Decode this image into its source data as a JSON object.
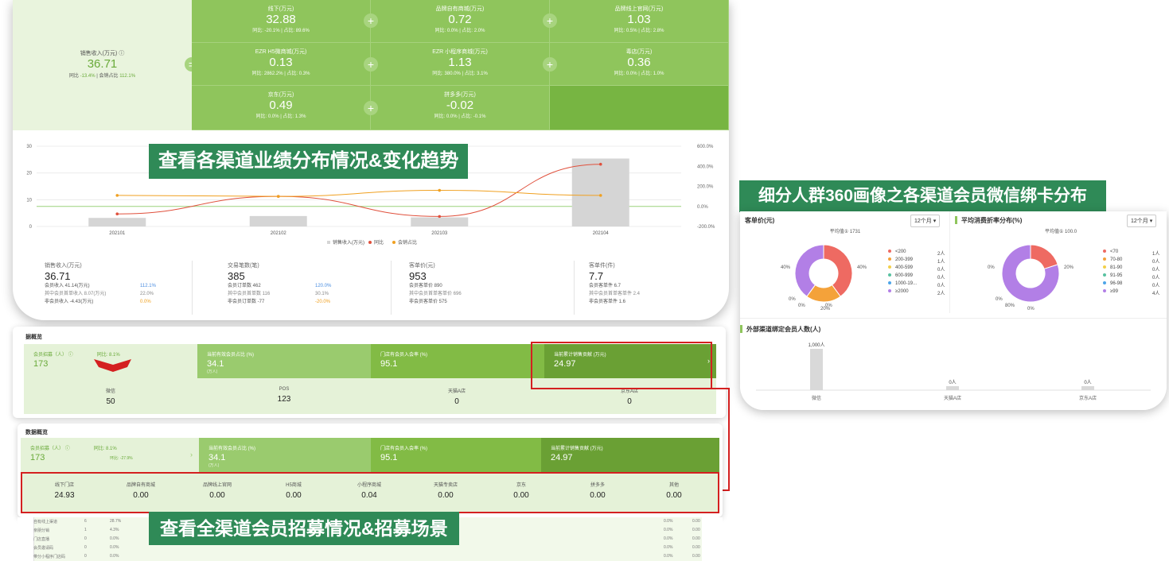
{
  "panelA": {
    "main": {
      "title": "销售收入(万元)",
      "value": "36.71",
      "sub_label1": "同比",
      "sub_value1": "-13.4%",
      "sub_label2": "会销占比",
      "sub_value2": "112.1%"
    },
    "cells": [
      {
        "title": "线下(万元)",
        "value": "32.88",
        "sub": "同比: -20.1% | 占比: 89.6%"
      },
      {
        "title": "品牌自有商城(万元)",
        "value": "0.72",
        "sub": "同比: 0.0% | 占比: 2.0%"
      },
      {
        "title": "品牌线上官网(万元)",
        "value": "1.03",
        "sub": "同比: 0.5% | 占比: 2.8%"
      },
      {
        "title": "EZR H5微商城(万元)",
        "value": "0.13",
        "sub": "同比: 2862.2% | 占比: 0.3%"
      },
      {
        "title": "EZR 小程序商城(万元)",
        "value": "1.13",
        "sub": "同比: 380.0% | 占比: 3.1%"
      },
      {
        "title": "毒店(万元)",
        "value": "0.36",
        "sub": "同比: 0.0% | 占比: 1.0%"
      },
      {
        "title": "京东(万元)",
        "value": "0.49",
        "sub": "同比: 0.0% | 占比: 1.3%"
      },
      {
        "title": "拼多多(万元)",
        "value": "-0.02",
        "sub": "同比: 0.0% | 占比: -0.1%"
      }
    ],
    "chart_data": {
      "type": "bar",
      "categories": [
        "202101",
        "202102",
        "202103",
        "202104"
      ],
      "ylim": [
        0,
        30
      ],
      "yticks": [
        "30",
        "20",
        "10",
        "0"
      ],
      "y2ticks": [
        "600.0%",
        "400.0%",
        "200.0%",
        "0.0%",
        "-200.0%"
      ],
      "series": [
        {
          "name": "销售收入(万元)",
          "values": [
            3.2,
            3.9,
            3.4,
            25.4
          ],
          "color": "#d5d5d5"
        },
        {
          "name": "同比",
          "values": [
            -75,
            100,
            -100,
            420
          ],
          "color": "#e0503c"
        },
        {
          "name": "会销占比",
          "values": [
            110,
            100,
            160,
            110
          ],
          "color": "#f0a020"
        }
      ]
    },
    "stats": [
      {
        "title": "销售收入(万元)",
        "value": "36.71",
        "l1": "会员收入  41.14(万元)",
        "r1": "112.1%",
        "l2": "其中会员首单收入  8.07(万元)",
        "r2": "22.0%",
        "l3": "非会员收入  -4.43(万元)",
        "r3": "0.0%"
      },
      {
        "title": "交易笔数(笔)",
        "value": "385",
        "l1": "会员订单数  462",
        "r1": "120.0%",
        "l2": "其中会员首单数  116",
        "r2": "30.1%",
        "l3": "非会员订单数  -77",
        "r3": "-20.0%"
      },
      {
        "title": "客单价(元)",
        "value": "953",
        "l1": "会员客单价  890",
        "l2": "其中会员首单客单价  696",
        "l3": "非会员客单价  575"
      },
      {
        "title": "客单件(件)",
        "value": "7.7",
        "l1": "会员客单件  6.7",
        "l2": "其中会员首单客单件  2.4",
        "l3": "非会员客单件  1.6"
      }
    ]
  },
  "banners": {
    "a": "查看各渠道业绩分布情况&变化趋势",
    "b": "细分人群360画像之各渠道会员微信绑卡分布",
    "c": "查看全渠道会员招募情况&招募场景"
  },
  "panelB": {
    "header": "据概览",
    "tiles": [
      {
        "title": "会员招募（人）",
        "value": "173",
        "extra": "同比: 8.1%"
      },
      {
        "title": "当前有效会员占比 (%)",
        "value": "34.1",
        "extra": "(万人)"
      },
      {
        "title": "门店有会员入会率 (%)",
        "value": "95.1"
      },
      {
        "title": "当前累计销售贡献 (万元)",
        "value": "24.97"
      }
    ],
    "counts": [
      {
        "label": "微信",
        "value": "50"
      },
      {
        "label": "POS",
        "value": "123"
      },
      {
        "label": "天猫A店",
        "value": "0"
      },
      {
        "label": "京东A店",
        "value": "0"
      }
    ]
  },
  "panelC": {
    "header": "数据概览",
    "tiles": [
      {
        "title": "会员招募（人）",
        "value": "173",
        "extra1": "同比: 8.1%",
        "extra2": "环比: -27.9%"
      },
      {
        "title": "当前有效会员占比 (%)",
        "value": "34.1",
        "extra": "(万人)"
      },
      {
        "title": "门店有会员入会率 (%)",
        "value": "95.1"
      },
      {
        "title": "当前累计销售贡献 (万元)",
        "value": "24.97"
      }
    ],
    "columns": [
      {
        "label": "线下门店",
        "value": "24.93"
      },
      {
        "label": "品牌自有商城",
        "value": "0.00"
      },
      {
        "label": "品牌线上官网",
        "value": "0.00"
      },
      {
        "label": "H5商城",
        "value": "0.00"
      },
      {
        "label": "小程序商城",
        "value": "0.04"
      },
      {
        "label": "天猫专卖店",
        "value": "0.00"
      },
      {
        "label": "京东",
        "value": "0.00"
      },
      {
        "label": "拼多多",
        "value": "0.00"
      },
      {
        "label": "其他",
        "value": "0.00"
      }
    ],
    "table_rows": [
      {
        "name": "自有线上渠道",
        "c1": "6",
        "c2": "28.7%",
        "c3": "0.0%",
        "c4": "0.00"
      },
      {
        "name": "亲朋分销",
        "c1": "1",
        "c2": "4.3%",
        "c3": "0.0%",
        "c4": "0.00"
      },
      {
        "name": "门店直播",
        "c1": "0",
        "c2": "0.0%",
        "c3": "0.0%",
        "c4": "0.00"
      },
      {
        "name": "会员邀请码",
        "c1": "0",
        "c2": "0.0%",
        "c3": "0.0%",
        "c4": "0.00"
      },
      {
        "name": "带分小程序门店码",
        "c1": "0",
        "c2": "0.0%",
        "c3": "0.0%",
        "c4": "0.00"
      }
    ]
  },
  "panelD": {
    "left": {
      "title": "客单价(元)",
      "select": "12个月 ▾",
      "avg": "平均值① 1731",
      "chart_data": {
        "type": "pie",
        "labels": [
          "<200",
          "200-399",
          "400-599",
          "600-999",
          "1000-19...",
          "≥2000"
        ],
        "counts": [
          "2人",
          "1人",
          "0人",
          "0人",
          "0人",
          "2人"
        ],
        "values": [
          40,
          20,
          0,
          0,
          0,
          40
        ],
        "colors": [
          "#ee6a62",
          "#f4a23a",
          "#f2d04a",
          "#58c2a0",
          "#4da5e8",
          "#b27fe6"
        ],
        "slice_labels": [
          "40%",
          "40%",
          "20%",
          "0%",
          "0%",
          "0%"
        ]
      }
    },
    "right": {
      "title": "平均消费折率分布(%)",
      "select": "12个月 ▾",
      "avg": "平均值① 100.0",
      "chart_data": {
        "type": "pie",
        "labels": [
          "<70",
          "70-80",
          "81-90",
          "91-95",
          "96-98",
          "≥99"
        ],
        "counts": [
          "1人",
          "0人",
          "0人",
          "0人",
          "0人",
          "4人"
        ],
        "values": [
          20,
          0,
          0,
          0,
          0,
          80
        ],
        "colors": [
          "#ee6a62",
          "#f4a23a",
          "#f2d04a",
          "#58c2a0",
          "#4da5e8",
          "#b27fe6"
        ],
        "slice_labels": [
          "20%",
          "0%",
          "0%",
          "0%",
          "80%"
        ]
      }
    },
    "bottom": {
      "title": "外部渠道绑定会员人数(人)",
      "chart_data": {
        "type": "bar",
        "categories": [
          "微信",
          "天猫A店",
          "京东A店"
        ],
        "values": [
          1000,
          0,
          0
        ],
        "value_labels": [
          "1,000人",
          "0人",
          "0人"
        ]
      }
    }
  }
}
